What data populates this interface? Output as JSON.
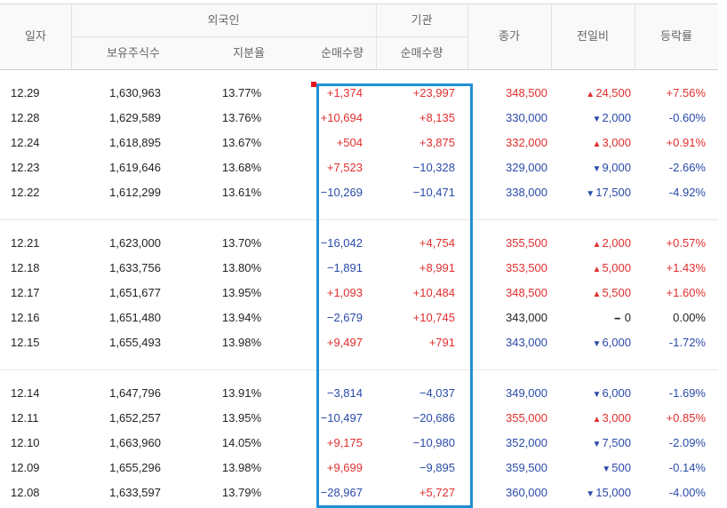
{
  "header": {
    "date": "일자",
    "foreign": "외국인",
    "institution": "기관",
    "holding_shares": "보유주식수",
    "holding_ratio": "지분율",
    "foreign_net": "순매수량",
    "institution_net": "순매수량",
    "close": "종가",
    "change": "전일비",
    "rate": "등락률"
  },
  "groups": [
    {
      "rows": [
        {
          "date": "12.29",
          "holding": "1,630,963",
          "ratio": "13.77%",
          "foreign_net": "+1,374",
          "inst_net": "+23,997",
          "close": "348,500",
          "change": "24,500",
          "direction": "up",
          "rate": "+7.56%"
        },
        {
          "date": "12.28",
          "holding": "1,629,589",
          "ratio": "13.76%",
          "foreign_net": "+10,694",
          "inst_net": "+8,135",
          "close": "330,000",
          "change": "2,000",
          "direction": "down",
          "rate": "-0.60%"
        },
        {
          "date": "12.24",
          "holding": "1,618,895",
          "ratio": "13.67%",
          "foreign_net": "+504",
          "inst_net": "+3,875",
          "close": "332,000",
          "change": "3,000",
          "direction": "up",
          "rate": "+0.91%"
        },
        {
          "date": "12.23",
          "holding": "1,619,646",
          "ratio": "13.68%",
          "foreign_net": "+7,523",
          "inst_net": "−10,328",
          "close": "329,000",
          "change": "9,000",
          "direction": "down",
          "rate": "-2.66%"
        },
        {
          "date": "12.22",
          "holding": "1,612,299",
          "ratio": "13.61%",
          "foreign_net": "−10,269",
          "inst_net": "−10,471",
          "close": "338,000",
          "change": "17,500",
          "direction": "down",
          "rate": "-4.92%"
        }
      ]
    },
    {
      "rows": [
        {
          "date": "12.21",
          "holding": "1,623,000",
          "ratio": "13.70%",
          "foreign_net": "−16,042",
          "inst_net": "+4,754",
          "close": "355,500",
          "change": "2,000",
          "direction": "up",
          "rate": "+0.57%"
        },
        {
          "date": "12.18",
          "holding": "1,633,756",
          "ratio": "13.80%",
          "foreign_net": "−1,891",
          "inst_net": "+8,991",
          "close": "353,500",
          "change": "5,000",
          "direction": "up",
          "rate": "+1.43%"
        },
        {
          "date": "12.17",
          "holding": "1,651,677",
          "ratio": "13.95%",
          "foreign_net": "+1,093",
          "inst_net": "+10,484",
          "close": "348,500",
          "change": "5,500",
          "direction": "up",
          "rate": "+1.60%"
        },
        {
          "date": "12.16",
          "holding": "1,651,480",
          "ratio": "13.94%",
          "foreign_net": "−2,679",
          "inst_net": "+10,745",
          "close": "343,000",
          "change": "0",
          "direction": "flat",
          "rate": "0.00%"
        },
        {
          "date": "12.15",
          "holding": "1,655,493",
          "ratio": "13.98%",
          "foreign_net": "+9,497",
          "inst_net": "+791",
          "close": "343,000",
          "change": "6,000",
          "direction": "down",
          "rate": "-1.72%"
        }
      ]
    },
    {
      "rows": [
        {
          "date": "12.14",
          "holding": "1,647,796",
          "ratio": "13.91%",
          "foreign_net": "−3,814",
          "inst_net": "−4,037",
          "close": "349,000",
          "change": "6,000",
          "direction": "down",
          "rate": "-1.69%"
        },
        {
          "date": "12.11",
          "holding": "1,652,257",
          "ratio": "13.95%",
          "foreign_net": "−10,497",
          "inst_net": "−20,686",
          "close": "355,000",
          "change": "3,000",
          "direction": "up",
          "rate": "+0.85%"
        },
        {
          "date": "12.10",
          "holding": "1,663,960",
          "ratio": "14.05%",
          "foreign_net": "+9,175",
          "inst_net": "−10,980",
          "close": "352,000",
          "change": "7,500",
          "direction": "down",
          "rate": "-2.09%"
        },
        {
          "date": "12.09",
          "holding": "1,655,296",
          "ratio": "13.98%",
          "foreign_net": "+9,699",
          "inst_net": "−9,895",
          "close": "359,500",
          "change": "500",
          "direction": "down",
          "rate": "-0.14%"
        },
        {
          "date": "12.08",
          "holding": "1,633,597",
          "ratio": "13.79%",
          "foreign_net": "−28,967",
          "inst_net": "+5,727",
          "close": "360,000",
          "change": "15,000",
          "direction": "down",
          "rate": "-4.00%"
        }
      ]
    }
  ],
  "colors": {
    "up": "#e12e2e",
    "down": "#2a4aa8",
    "highlight": "#1e90d6",
    "marker": "#e8141e"
  },
  "icons": {
    "up": "triangle-up-icon",
    "down": "triangle-down-icon",
    "flat": "dash-icon"
  }
}
